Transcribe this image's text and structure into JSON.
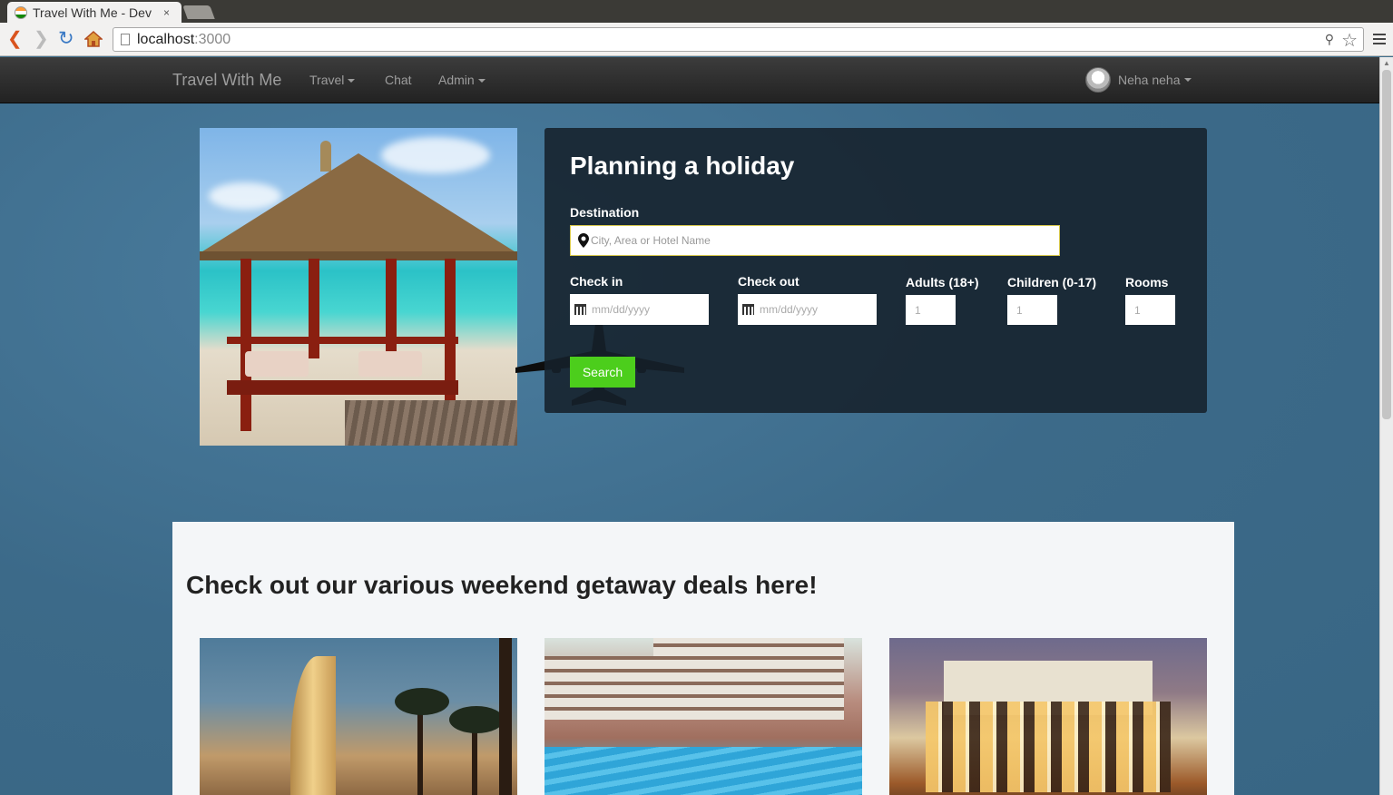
{
  "browser": {
    "tab_title": "Travel With Me - Dev",
    "tab_close": "×",
    "url_host": "localhost",
    "url_port": ":3000"
  },
  "navbar": {
    "brand": "Travel With Me",
    "travel": "Travel",
    "chat": "Chat",
    "admin": "Admin",
    "user": "Neha neha"
  },
  "search": {
    "title": "Planning a holiday",
    "destination_label": "Destination",
    "destination_placeholder": "City, Area or Hotel Name",
    "checkin_label": "Check in",
    "checkout_label": "Check out",
    "date_placeholder": "mm/dd/yyyy",
    "adults_label": "Adults (18+)",
    "children_label": "Children (0-17)",
    "rooms_label": "Rooms",
    "adults_placeholder": "1",
    "children_placeholder": "1",
    "rooms_placeholder": "1",
    "button": "Search",
    "button_color": "#4cce1c"
  },
  "deals": {
    "heading": "Check out our various weekend getaway deals here!"
  }
}
